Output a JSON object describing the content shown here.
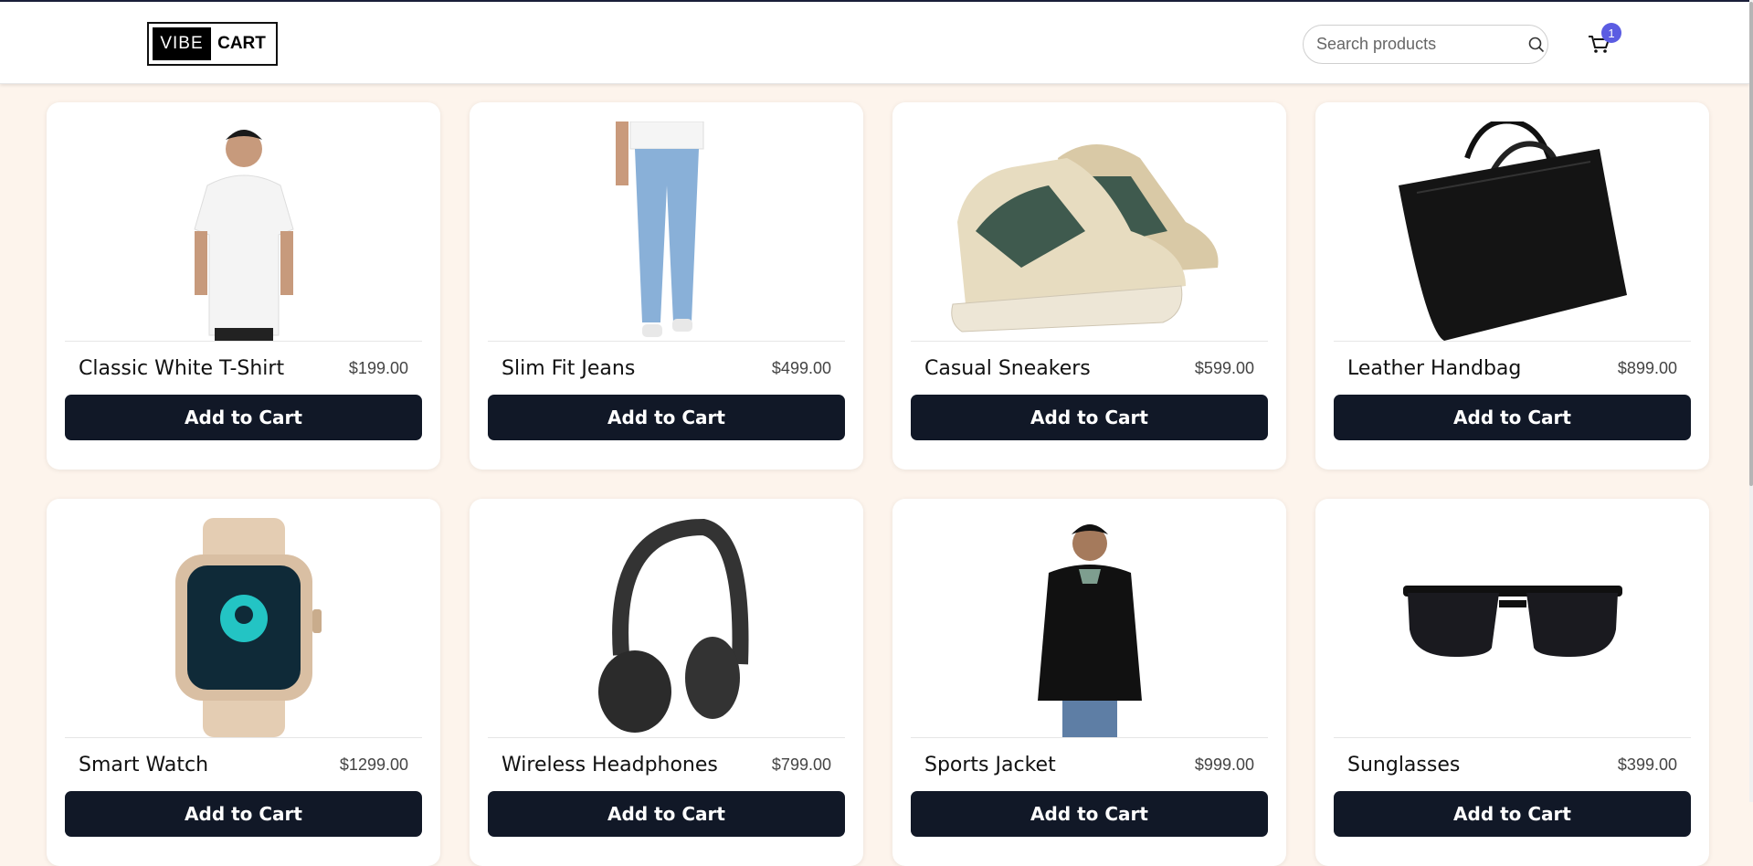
{
  "header": {
    "logo_left": "VIBE",
    "logo_right": "CART",
    "search_placeholder": "Search products",
    "cart_count": "1"
  },
  "products": [
    {
      "name": "Classic White T-Shirt",
      "price": "$199.00",
      "button": "Add to Cart",
      "image": "white-tshirt-model"
    },
    {
      "name": "Slim Fit Jeans",
      "price": "$499.00",
      "button": "Add to Cart",
      "image": "blue-jeans-model"
    },
    {
      "name": "Casual Sneakers",
      "price": "$599.00",
      "button": "Add to Cart",
      "image": "green-beige-sneakers"
    },
    {
      "name": "Leather Handbag",
      "price": "$899.00",
      "button": "Add to Cart",
      "image": "black-leather-tote"
    },
    {
      "name": "Smart Watch",
      "price": "$1299.00",
      "button": "Add to Cart",
      "image": "beige-smartwatch"
    },
    {
      "name": "Wireless Headphones",
      "price": "$799.00",
      "button": "Add to Cart",
      "image": "black-headphones"
    },
    {
      "name": "Sports Jacket",
      "price": "$999.00",
      "button": "Add to Cart",
      "image": "black-zip-jacket-model"
    },
    {
      "name": "Sunglasses",
      "price": "$399.00",
      "button": "Add to Cart",
      "image": "black-sunglasses"
    }
  ],
  "colors": {
    "page_bg": "#fdf4ec",
    "button_bg": "#111827",
    "badge_bg": "#5b5ce2"
  }
}
